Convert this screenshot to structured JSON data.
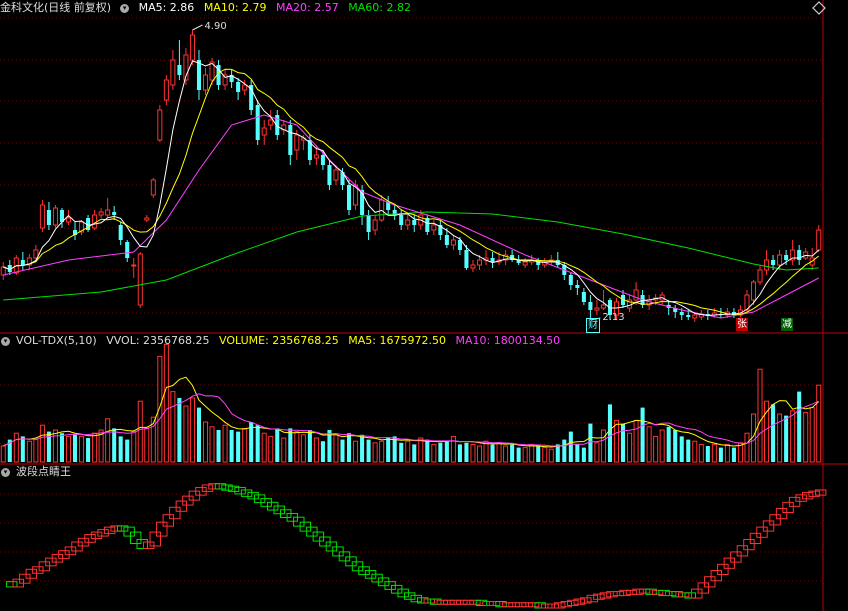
{
  "header_main": {
    "title": "金科文化(日线 前复权)",
    "ma5": "MA5: 2.86",
    "ma10": "MA10: 2.79",
    "ma20": "MA20: 2.57",
    "ma60": "MA60: 2.82"
  },
  "header_vol": {
    "title": "VOL-TDX(5,10)",
    "vvol": "VVOL: 2356768.25",
    "volume": "VOLUME: 2356768.25",
    "ma5": "MA5: 1675972.50",
    "ma10": "MA10: 1800134.50"
  },
  "header_ind": {
    "title": "波段点睛王"
  },
  "annotations": {
    "high": "4.90",
    "low": "2.13",
    "tag_cai": "财",
    "tag_zhang": "张",
    "tag_jian": "减"
  },
  "colors": {
    "up": "#ff3232",
    "down": "#54ffff",
    "ma5": "#ffffff",
    "ma10": "#ffff00",
    "ma20": "#ff40ff",
    "ma60": "#00e000",
    "grid": "#7a0000"
  },
  "chart_data": [
    {
      "type": "candlestick",
      "title": "金科文化(日线 前复权)",
      "y_range": [
        2.0,
        5.0
      ],
      "x_range": [
        0,
        126
      ],
      "candles": [
        [
          0,
          2.45,
          2.53,
          2.58,
          2.4
        ],
        [
          1,
          2.55,
          2.48,
          2.6,
          2.45
        ],
        [
          2,
          2.47,
          2.62,
          2.65,
          2.45
        ],
        [
          3,
          2.6,
          2.55,
          2.68,
          2.5
        ],
        [
          4,
          2.55,
          2.62,
          2.66,
          2.5
        ],
        [
          5,
          2.62,
          2.7,
          2.75,
          2.58
        ],
        [
          6,
          2.92,
          3.15,
          3.2,
          2.88
        ],
        [
          7,
          3.1,
          2.95,
          3.18,
          2.9
        ],
        [
          8,
          2.95,
          3.12,
          3.15,
          2.92
        ],
        [
          9,
          3.1,
          2.98,
          3.12,
          2.92
        ],
        [
          10,
          2.98,
          3.02,
          3.1,
          2.95
        ],
        [
          11,
          2.9,
          2.85,
          2.98,
          2.8
        ],
        [
          12,
          2.88,
          2.98,
          3.0,
          2.85
        ],
        [
          13,
          3.02,
          2.9,
          3.05,
          2.88
        ],
        [
          14,
          2.92,
          3.05,
          3.1,
          2.9
        ],
        [
          15,
          3.05,
          3.08,
          3.12,
          3.02
        ],
        [
          16,
          3.05,
          3.1,
          3.22,
          3.02
        ],
        [
          17,
          3.08,
          3.05,
          3.14,
          3.0
        ],
        [
          18,
          2.95,
          2.8,
          2.98,
          2.75
        ],
        [
          19,
          2.78,
          2.62,
          2.8,
          2.58
        ],
        [
          20,
          2.55,
          2.55,
          2.62,
          2.42
        ],
        [
          21,
          2.15,
          2.66,
          2.68,
          2.12
        ],
        [
          22,
          3.0,
          3.02,
          3.05,
          2.98
        ],
        [
          23,
          3.25,
          3.4,
          3.42,
          3.22
        ],
        [
          24,
          3.8,
          4.1,
          4.15,
          3.78
        ],
        [
          25,
          4.2,
          4.4,
          4.45,
          4.15
        ],
        [
          26,
          4.35,
          4.6,
          4.7,
          4.3
        ],
        [
          27,
          4.55,
          4.45,
          4.8,
          4.4
        ],
        [
          28,
          4.4,
          4.65,
          4.72,
          4.35
        ],
        [
          29,
          4.6,
          4.85,
          4.9,
          4.55
        ],
        [
          30,
          4.6,
          4.3,
          4.7,
          4.2
        ],
        [
          31,
          4.3,
          4.45,
          4.52,
          4.25
        ],
        [
          32,
          4.4,
          4.58,
          4.62,
          4.35
        ],
        [
          33,
          4.55,
          4.35,
          4.6,
          4.3
        ],
        [
          34,
          4.35,
          4.45,
          4.5,
          4.3
        ],
        [
          35,
          4.45,
          4.38,
          4.5,
          4.32
        ],
        [
          36,
          4.38,
          4.28,
          4.42,
          4.2
        ],
        [
          37,
          4.3,
          4.35,
          4.4,
          4.25
        ],
        [
          38,
          4.35,
          4.1,
          4.4,
          4.05
        ],
        [
          39,
          4.15,
          3.8,
          4.2,
          3.75
        ],
        [
          40,
          3.85,
          3.92,
          4.0,
          3.75
        ],
        [
          41,
          3.95,
          4.0,
          4.1,
          3.9
        ],
        [
          42,
          4.05,
          3.85,
          4.1,
          3.8
        ],
        [
          43,
          3.9,
          3.95,
          4.0,
          3.85
        ],
        [
          44,
          3.95,
          3.65,
          4.0,
          3.55
        ],
        [
          45,
          3.7,
          3.85,
          3.9,
          3.6
        ],
        [
          46,
          3.8,
          3.82,
          3.85,
          3.7
        ],
        [
          47,
          3.8,
          3.6,
          3.85,
          3.55
        ],
        [
          48,
          3.62,
          3.65,
          3.75,
          3.55
        ],
        [
          49,
          3.65,
          3.55,
          3.7,
          3.5
        ],
        [
          50,
          3.55,
          3.35,
          3.6,
          3.3
        ],
        [
          51,
          3.4,
          3.5,
          3.55,
          3.35
        ],
        [
          52,
          3.48,
          3.35,
          3.52,
          3.3
        ],
        [
          53,
          3.35,
          3.1,
          3.4,
          3.05
        ],
        [
          54,
          3.15,
          3.35,
          3.4,
          3.1
        ],
        [
          55,
          3.3,
          3.05,
          3.35,
          2.95
        ],
        [
          56,
          3.05,
          2.88,
          3.1,
          2.8
        ],
        [
          57,
          2.9,
          3.0,
          3.05,
          2.85
        ],
        [
          58,
          3.0,
          3.2,
          3.25,
          2.98
        ],
        [
          59,
          3.18,
          3.1,
          3.24,
          3.05
        ],
        [
          60,
          3.1,
          3.05,
          3.15,
          3.0
        ],
        [
          61,
          3.05,
          2.95,
          3.1,
          2.9
        ],
        [
          62,
          2.95,
          3.0,
          3.05,
          2.9
        ],
        [
          63,
          3.0,
          2.95,
          3.05,
          2.88
        ],
        [
          64,
          2.95,
          3.05,
          3.1,
          2.9
        ],
        [
          65,
          3.02,
          2.88,
          3.05,
          2.85
        ],
        [
          66,
          2.9,
          2.95,
          3.0,
          2.85
        ],
        [
          67,
          2.95,
          2.85,
          3.0,
          2.8
        ],
        [
          68,
          2.85,
          2.75,
          2.92,
          2.72
        ],
        [
          69,
          2.75,
          2.8,
          2.85,
          2.7
        ],
        [
          70,
          2.8,
          2.7,
          2.83,
          2.65
        ],
        [
          71,
          2.7,
          2.52,
          2.75,
          2.5
        ],
        [
          72,
          2.52,
          2.55,
          2.6,
          2.48
        ],
        [
          73,
          2.55,
          2.6,
          2.65,
          2.5
        ],
        [
          74,
          2.6,
          2.62,
          2.7,
          2.55
        ],
        [
          75,
          2.62,
          2.58,
          2.68,
          2.52
        ],
        [
          76,
          2.58,
          2.6,
          2.68,
          2.55
        ],
        [
          77,
          2.6,
          2.65,
          2.7,
          2.55
        ],
        [
          78,
          2.65,
          2.6,
          2.7,
          2.58
        ],
        [
          79,
          2.6,
          2.57,
          2.65,
          2.55
        ],
        [
          80,
          2.55,
          2.58,
          2.62,
          2.52
        ],
        [
          81,
          2.58,
          2.6,
          2.65,
          2.55
        ],
        [
          82,
          2.6,
          2.55,
          2.62,
          2.5
        ],
        [
          83,
          2.55,
          2.58,
          2.62,
          2.52
        ],
        [
          84,
          2.58,
          2.6,
          2.65,
          2.55
        ],
        [
          85,
          2.6,
          2.55,
          2.68,
          2.52
        ],
        [
          86,
          2.55,
          2.45,
          2.58,
          2.4
        ],
        [
          87,
          2.45,
          2.35,
          2.48,
          2.3
        ],
        [
          88,
          2.35,
          2.32,
          2.4,
          2.25
        ],
        [
          89,
          2.28,
          2.18,
          2.32,
          2.15
        ],
        [
          90,
          2.18,
          2.1,
          2.25,
          2.0
        ],
        [
          91,
          2.1,
          2.12,
          2.2,
          2.05
        ],
        [
          92,
          2.12,
          2.15,
          2.3,
          2.1
        ],
        [
          93,
          2.2,
          2.05,
          2.22,
          2.0
        ],
        [
          94,
          2.05,
          2.18,
          2.22,
          2.0
        ],
        [
          95,
          2.25,
          2.15,
          2.3,
          2.12
        ],
        [
          96,
          2.12,
          2.2,
          2.25,
          2.08
        ],
        [
          97,
          2.2,
          2.3,
          2.38,
          2.15
        ],
        [
          98,
          2.25,
          2.15,
          2.3,
          2.12
        ],
        [
          99,
          2.15,
          2.2,
          2.25,
          2.1
        ],
        [
          100,
          2.2,
          2.22,
          2.26,
          2.15
        ],
        [
          101,
          2.2,
          2.25,
          2.28,
          2.15
        ],
        [
          102,
          2.15,
          2.12,
          2.2,
          2.05
        ],
        [
          103,
          2.12,
          2.08,
          2.15,
          2.02
        ],
        [
          104,
          2.08,
          2.05,
          2.12,
          2.0
        ],
        [
          105,
          2.05,
          2.03,
          2.1,
          2.0
        ],
        [
          106,
          2.02,
          2.05,
          2.08,
          1.98
        ],
        [
          107,
          2.03,
          2.06,
          2.1,
          2.0
        ],
        [
          108,
          2.06,
          2.04,
          2.1,
          2.0
        ],
        [
          109,
          2.05,
          2.07,
          2.12,
          2.02
        ],
        [
          110,
          2.06,
          2.05,
          2.12,
          2.02
        ],
        [
          111,
          2.05,
          2.08,
          2.12,
          2.02
        ],
        [
          112,
          2.08,
          2.05,
          2.12,
          2.02
        ],
        [
          113,
          2.05,
          2.1,
          2.15,
          2.03
        ],
        [
          114,
          2.1,
          2.25,
          2.3,
          2.08
        ],
        [
          115,
          2.2,
          2.38,
          2.4,
          2.15
        ],
        [
          116,
          2.38,
          2.5,
          2.55,
          2.35
        ],
        [
          117,
          2.5,
          2.6,
          2.7,
          2.45
        ],
        [
          118,
          2.6,
          2.55,
          2.65,
          2.5
        ],
        [
          119,
          2.55,
          2.65,
          2.7,
          2.5
        ],
        [
          120,
          2.65,
          2.6,
          2.7,
          2.55
        ],
        [
          121,
          2.6,
          2.7,
          2.8,
          2.55
        ],
        [
          122,
          2.7,
          2.6,
          2.75,
          2.55
        ],
        [
          123,
          2.62,
          2.68,
          2.72,
          2.6
        ],
        [
          124,
          2.55,
          2.62,
          2.72,
          2.5
        ],
        [
          125,
          2.7,
          2.9,
          2.95,
          2.68
        ]
      ],
      "ma_windows": {
        "ma5": 5,
        "ma10": 10,
        "ma20": 20
      },
      "ma60_points": [
        [
          0,
          2.2
        ],
        [
          15,
          2.28
        ],
        [
          25,
          2.4
        ],
        [
          35,
          2.65
        ],
        [
          45,
          2.88
        ],
        [
          55,
          3.04
        ],
        [
          65,
          3.08
        ],
        [
          75,
          3.06
        ],
        [
          85,
          2.98
        ],
        [
          95,
          2.86
        ],
        [
          105,
          2.72
        ],
        [
          115,
          2.56
        ],
        [
          120,
          2.5
        ],
        [
          125,
          2.52
        ]
      ],
      "ma20_points": [
        [
          0,
          2.45
        ],
        [
          10,
          2.6
        ],
        [
          20,
          2.68
        ],
        [
          25,
          3.0
        ],
        [
          30,
          3.5
        ],
        [
          35,
          3.95
        ],
        [
          40,
          4.05
        ],
        [
          45,
          3.95
        ],
        [
          50,
          3.6
        ],
        [
          55,
          3.28
        ],
        [
          60,
          3.15
        ],
        [
          70,
          2.95
        ],
        [
          80,
          2.65
        ],
        [
          86,
          2.5
        ],
        [
          92,
          2.35
        ],
        [
          98,
          2.2
        ],
        [
          104,
          2.1
        ],
        [
          110,
          2.02
        ],
        [
          115,
          2.08
        ],
        [
          120,
          2.25
        ],
        [
          125,
          2.42
        ]
      ]
    },
    {
      "type": "bar",
      "title": "VOL-TDX(5,10)",
      "y_range": [
        0,
        3500000
      ],
      "volumes": [
        500000,
        700000,
        900000,
        800000,
        650000,
        700000,
        1150000,
        950000,
        1000000,
        900000,
        800000,
        850000,
        800000,
        750000,
        900000,
        1000000,
        1350000,
        1050000,
        800000,
        700000,
        950000,
        1900000,
        1050000,
        1400000,
        3300000,
        4000000,
        2200000,
        2000000,
        1750000,
        2000000,
        1700000,
        1250000,
        1100000,
        1000000,
        1150000,
        1000000,
        950000,
        1050000,
        1250000,
        1150000,
        900000,
        800000,
        1050000,
        750000,
        1050000,
        950000,
        850000,
        1000000,
        750000,
        650000,
        1000000,
        850000,
        700000,
        900000,
        650000,
        850000,
        700000,
        600000,
        650000,
        750000,
        800000,
        600000,
        650000,
        550000,
        750000,
        700000,
        550000,
        600000,
        650000,
        800000,
        550000,
        600000,
        550000,
        500000,
        650000,
        550000,
        600000,
        500000,
        550000,
        450000,
        450000,
        550000,
        500000,
        450000,
        400000,
        550000,
        700000,
        950000,
        550000,
        450000,
        1200000,
        600000,
        1000000,
        1800000,
        1300000,
        1200000,
        900000,
        1300000,
        1700000,
        1100000,
        800000,
        1000000,
        1100000,
        1000000,
        800000,
        700000,
        650000,
        550000,
        500000,
        550000,
        450000,
        550000,
        450000,
        600000,
        900000,
        1500000,
        2900000,
        1900000,
        1800000,
        1500000,
        1450000,
        1600000,
        2200000,
        1550000,
        1700000,
        2400000
      ],
      "summary": {
        "vvol": 2356768.25,
        "volume": 2356768.25,
        "ma5": 1675972.5,
        "ma10": 1800134.5
      }
    },
    {
      "type": "line",
      "title": "波段点睛王",
      "y_range": [
        0,
        100
      ],
      "series": [
        {
          "values": [
            18,
            17,
            20,
            24,
            28,
            30,
            34,
            37,
            40,
            43,
            46,
            50,
            53,
            56,
            58,
            60,
            62,
            63,
            62,
            58,
            52,
            48,
            50,
            58,
            66,
            72,
            78,
            83,
            87,
            91,
            94,
            96,
            97,
            96,
            95,
            94,
            92,
            90,
            88,
            85,
            82,
            79,
            76,
            73,
            70,
            66,
            62,
            58,
            54,
            50,
            46,
            42,
            38,
            34,
            30,
            27,
            24,
            21,
            18,
            15,
            12,
            9,
            7,
            5,
            4,
            4,
            3,
            3,
            3,
            3,
            3,
            3,
            3,
            2,
            2,
            2,
            1,
            1,
            1,
            1,
            1,
            1,
            0,
            0,
            0,
            1,
            2,
            3,
            4,
            5,
            7,
            8,
            9,
            10,
            10,
            11,
            11,
            12,
            12,
            11,
            11,
            10,
            10,
            9,
            9,
            8,
            12,
            17,
            22,
            27,
            32,
            37,
            42,
            47,
            52,
            57,
            62,
            67,
            72,
            77,
            82,
            86,
            88,
            90,
            91,
            92
          ]
        }
      ]
    }
  ]
}
